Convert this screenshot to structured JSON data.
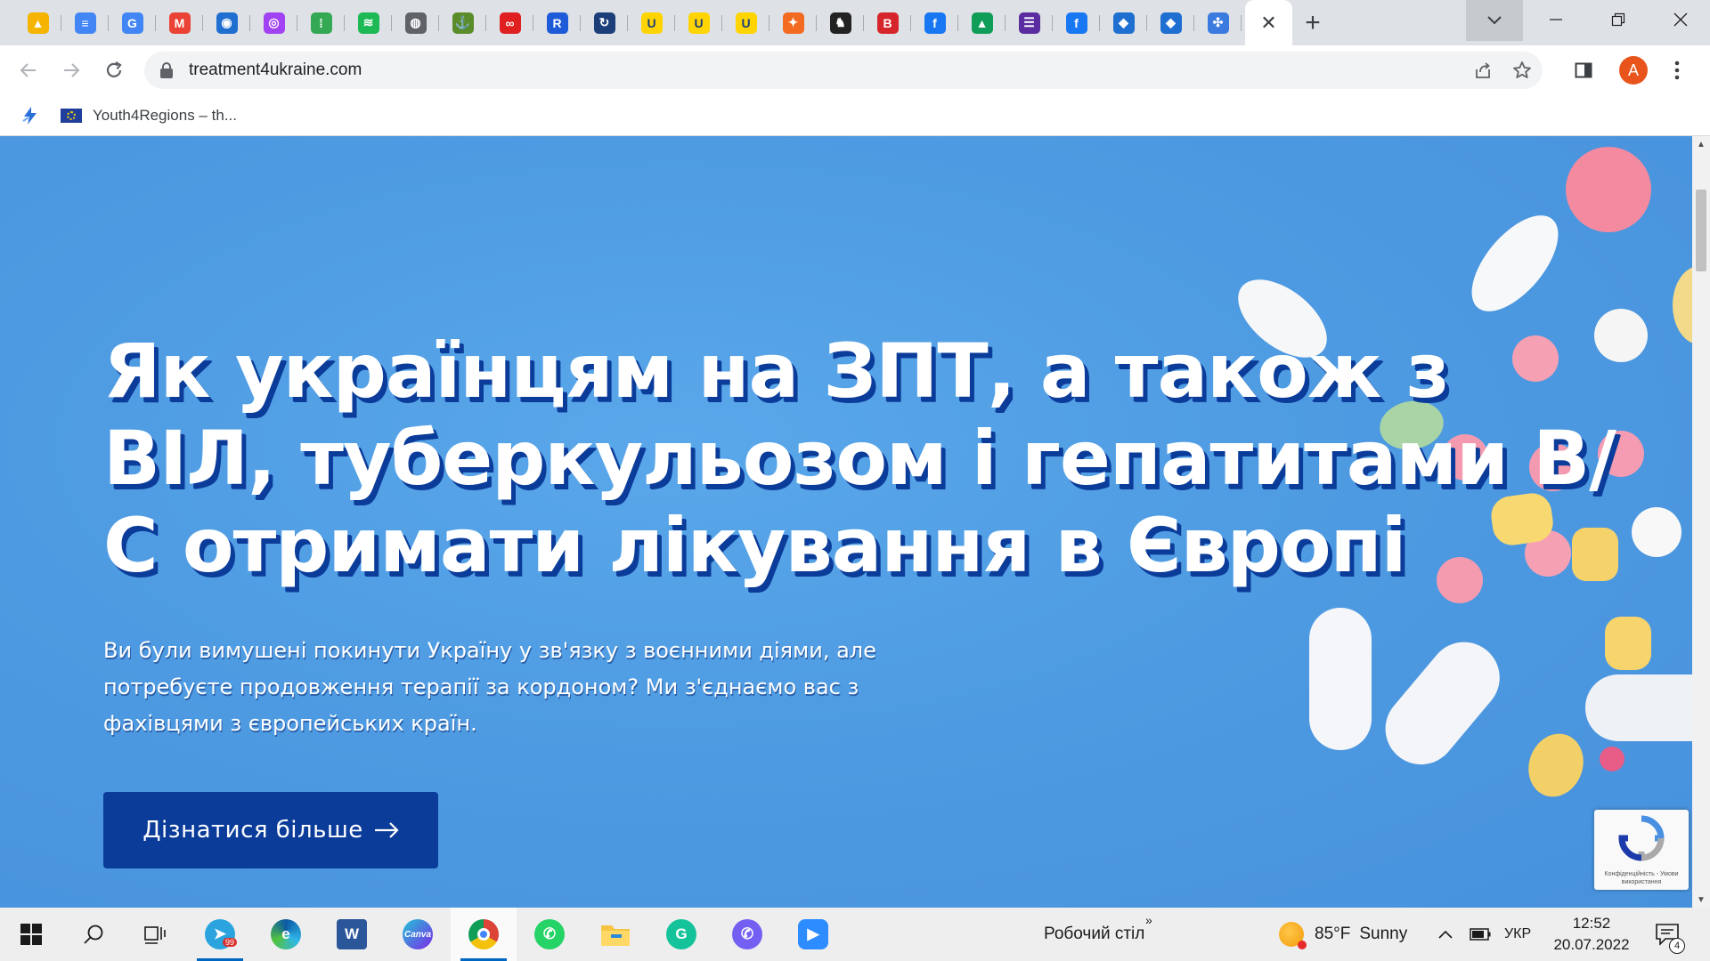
{
  "browser": {
    "tabs": [
      {
        "icon": "google-drive-icon",
        "color": "#f4b400",
        "glyph": "▲"
      },
      {
        "icon": "google-docs-icon",
        "color": "#4285f4",
        "glyph": "≡"
      },
      {
        "icon": "google-translate-icon",
        "color": "#4285f4",
        "glyph": "G"
      },
      {
        "icon": "gmail-icon",
        "color": "#ea4335",
        "glyph": "M"
      },
      {
        "icon": "ukraine-ring-icon",
        "color": "#1f6fd1",
        "glyph": "◉"
      },
      {
        "icon": "podcasts-icon",
        "color": "#a142f4",
        "glyph": "◎"
      },
      {
        "icon": "google-podcasts-icon",
        "color": "#34a853",
        "glyph": "⁞"
      },
      {
        "icon": "spotify-icon",
        "color": "#1db954",
        "glyph": "≋"
      },
      {
        "icon": "globe-icon",
        "color": "#5f6368",
        "glyph": "◍"
      },
      {
        "icon": "anchor-icon",
        "color": "#5b8c2a",
        "glyph": "⚓"
      },
      {
        "icon": "infinity-icon",
        "color": "#e02020",
        "glyph": "∞"
      },
      {
        "icon": "app-r-icon",
        "color": "#1e5bd8",
        "glyph": "R"
      },
      {
        "icon": "sync-circle-icon",
        "color": "#1c3f7a",
        "glyph": "↻"
      },
      {
        "icon": "u-yellow-icon",
        "color": "#ffd400",
        "glyph": "U"
      },
      {
        "icon": "u-yellow-icon",
        "color": "#ffd400",
        "glyph": "U"
      },
      {
        "icon": "u-yellow-icon",
        "color": "#ffd400",
        "glyph": "U"
      },
      {
        "icon": "figure-orange-icon",
        "color": "#f36b21",
        "glyph": "✦"
      },
      {
        "icon": "cat-icon",
        "color": "#222222",
        "glyph": "♞"
      },
      {
        "icon": "b-red-icon",
        "color": "#d7262b",
        "glyph": "B"
      },
      {
        "icon": "facebook-icon",
        "color": "#1877f2",
        "glyph": "f"
      },
      {
        "icon": "google-drive-icon",
        "color": "#0f9d58",
        "glyph": "▲"
      },
      {
        "icon": "list-purple-icon",
        "color": "#5a2ca0",
        "glyph": "☰"
      },
      {
        "icon": "facebook-icon",
        "color": "#1877f2",
        "glyph": "f"
      },
      {
        "icon": "ukraine-shield-icon",
        "color": "#1f6fd1",
        "glyph": "◆"
      },
      {
        "icon": "ukraine-shield-icon",
        "color": "#1f6fd1",
        "glyph": "◆"
      },
      {
        "icon": "compass-icon",
        "color": "#3b7be0",
        "glyph": "✣"
      }
    ],
    "active_tab_close": "✕",
    "new_tab": "+",
    "url": "treatment4ukraine.com",
    "bookmarks": [
      {
        "label": ""
      },
      {
        "label": "Youth4Regions – th..."
      }
    ]
  },
  "hero": {
    "title": "Як українцям на ЗПТ, а також з ВІЛ, туберкульозом і гепатитами В/С отримати лікування в Європі",
    "text": "Ви були вимушені покинути Україну у зв'язку з воєнними діями, але потребуєте продовження терапії за кордоном? Ми з'єднаємо вас з фахівцями з європейських країн.",
    "cta": "Дізнатися більше",
    "recaptcha_text": "Конфіденційність - Умови використання"
  },
  "taskbar": {
    "desktop_label": "Робочий стіл",
    "telegram_badge": "99",
    "weather": {
      "temp": "85°F",
      "desc": "Sunny"
    },
    "language": "УКР",
    "time": "12:52",
    "date": "20.07.2022",
    "notifications": "4"
  },
  "colors": {
    "brand_blue": "#0b3c9a",
    "hero_bg": "#4e9be2"
  }
}
